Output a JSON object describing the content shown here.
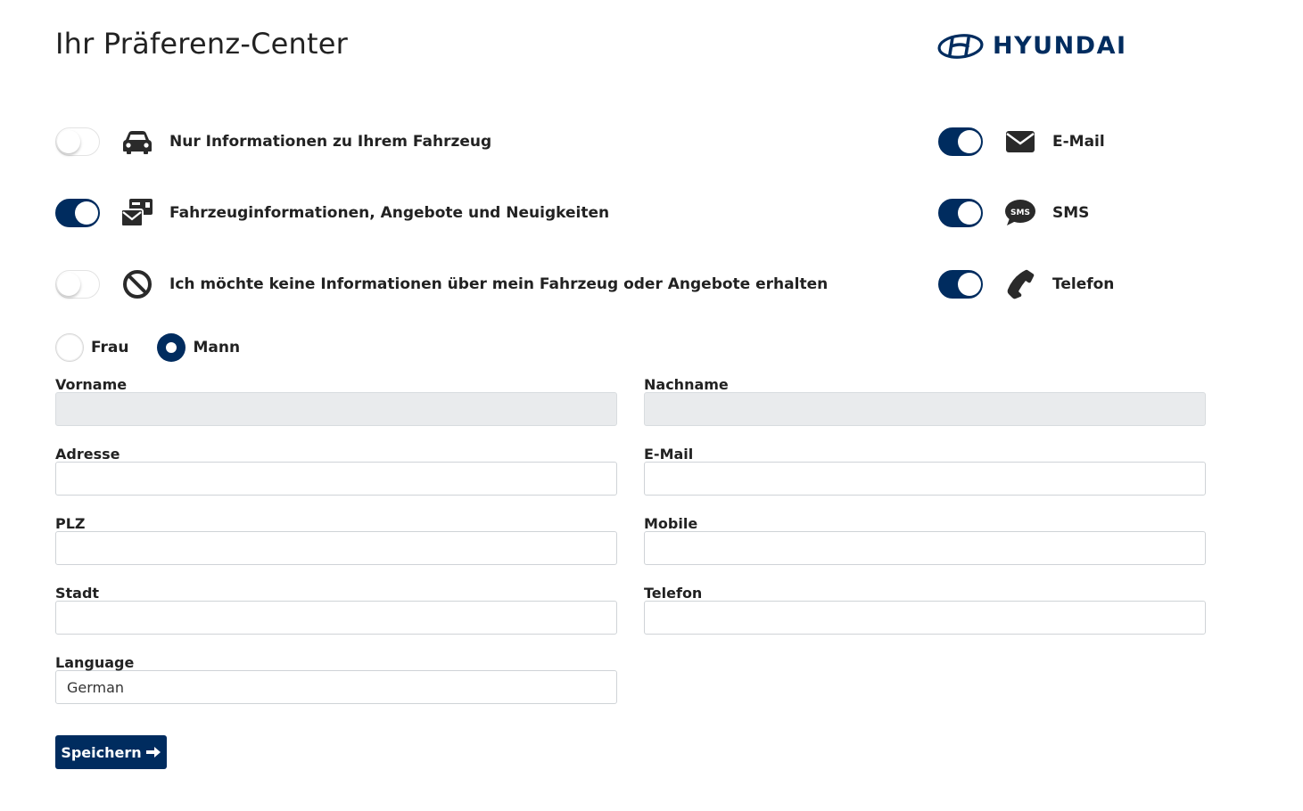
{
  "header": {
    "title": "Ihr Präferenz-Center",
    "brand": "HYUNDAI",
    "brand_color": "#002c5f"
  },
  "preferences": {
    "info_options": [
      {
        "label": "Nur Informationen zu Ihrem Fahrzeug",
        "icon": "car-icon",
        "enabled": false
      },
      {
        "label": "Fahrzeuginformationen, Angebote und Neuigkeiten",
        "icon": "mail-stack-icon",
        "enabled": true
      },
      {
        "label": "Ich möchte keine Informationen über mein Fahrzeug oder Angebote erhalten",
        "icon": "ban-icon",
        "enabled": false
      }
    ],
    "channels": [
      {
        "label": "E-Mail",
        "icon": "envelope-icon",
        "enabled": true
      },
      {
        "label": "SMS",
        "icon": "sms-icon",
        "icon_text": "SMS",
        "enabled": true
      },
      {
        "label": "Telefon",
        "icon": "phone-icon",
        "enabled": true
      }
    ]
  },
  "salutation": {
    "options": [
      {
        "label": "Frau",
        "selected": false
      },
      {
        "label": "Mann",
        "selected": true
      }
    ]
  },
  "form": {
    "vorname": {
      "label": "Vorname",
      "value": "",
      "disabled": true
    },
    "nachname": {
      "label": "Nachname",
      "value": "",
      "disabled": true
    },
    "adresse": {
      "label": "Adresse",
      "value": ""
    },
    "email": {
      "label": "E-Mail",
      "value": ""
    },
    "plz": {
      "label": "PLZ",
      "value": ""
    },
    "mobile": {
      "label": "Mobile",
      "value": ""
    },
    "stadt": {
      "label": "Stadt",
      "value": ""
    },
    "telefon": {
      "label": "Telefon",
      "value": ""
    },
    "language": {
      "label": "Language",
      "value": "German"
    }
  },
  "actions": {
    "save_label": "Speichern"
  }
}
